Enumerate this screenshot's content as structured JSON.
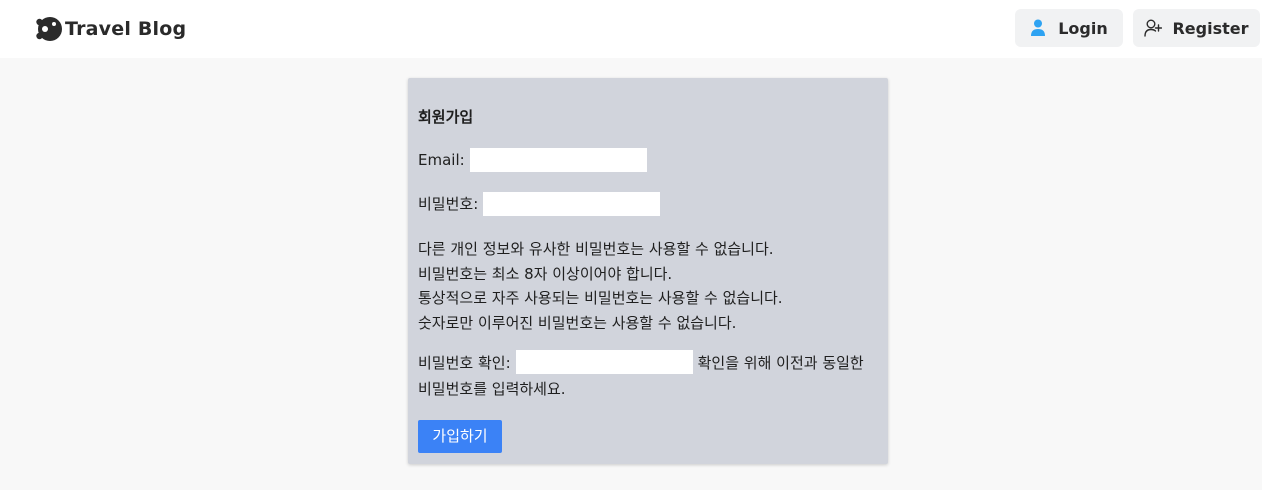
{
  "brand": {
    "name": "Travel Blog"
  },
  "nav": {
    "login_label": "Login",
    "register_label": "Register"
  },
  "colors": {
    "accent": "#3b82f6",
    "login_icon": "#2ea3f2",
    "card_bg": "#d1d4dc",
    "page_bg": "#f8f8f8"
  },
  "icons": {
    "brand": "travel-blog-logo-icon",
    "login": "user-icon",
    "register": "user-plus-icon"
  },
  "form": {
    "title": "회원가입",
    "email_label": "Email:",
    "email_value": "",
    "password_label": "비밀번호:",
    "password_value": "",
    "help_texts": [
      "다른 개인 정보와 유사한 비밀번호는 사용할 수 없습니다.",
      "비밀번호는 최소 8자 이상이어야 합니다.",
      "통상적으로 자주 사용되는 비밀번호는 사용할 수 없습니다.",
      "숫자로만 이루어진 비밀번호는 사용할 수 없습니다."
    ],
    "confirm_label": "비밀번호 확인:",
    "confirm_value": "",
    "confirm_help": "확인을 위해 이전과 동일한 비밀번호를 입력하세요.",
    "submit_label": "가입하기"
  }
}
